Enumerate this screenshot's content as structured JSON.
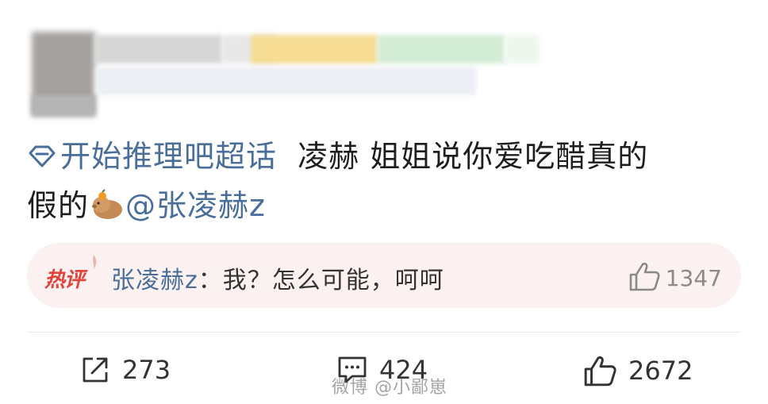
{
  "post": {
    "topic": "开始推理吧超话",
    "text_1": "  凌赫 姐姐说你爱吃醋真的",
    "text_2": "假的",
    "mention": "@张凌赫z"
  },
  "hot_comment": {
    "badge": "热评",
    "author": "张凌赫z",
    "separator": "：",
    "text": "我？怎么可能，呵呵",
    "likes": "1347"
  },
  "actions": {
    "reposts": "273",
    "comments": "424",
    "likes": "2672"
  },
  "watermark": "微博 @小鄙崽",
  "colors": {
    "link": "#4a6e9a",
    "hot_badge": "#e0443a",
    "hot_bg": "#fbf1f1"
  },
  "icons": [
    "diamond-icon",
    "capybara-sticker-icon",
    "thumbs-up-icon",
    "repost-icon",
    "comment-icon"
  ]
}
